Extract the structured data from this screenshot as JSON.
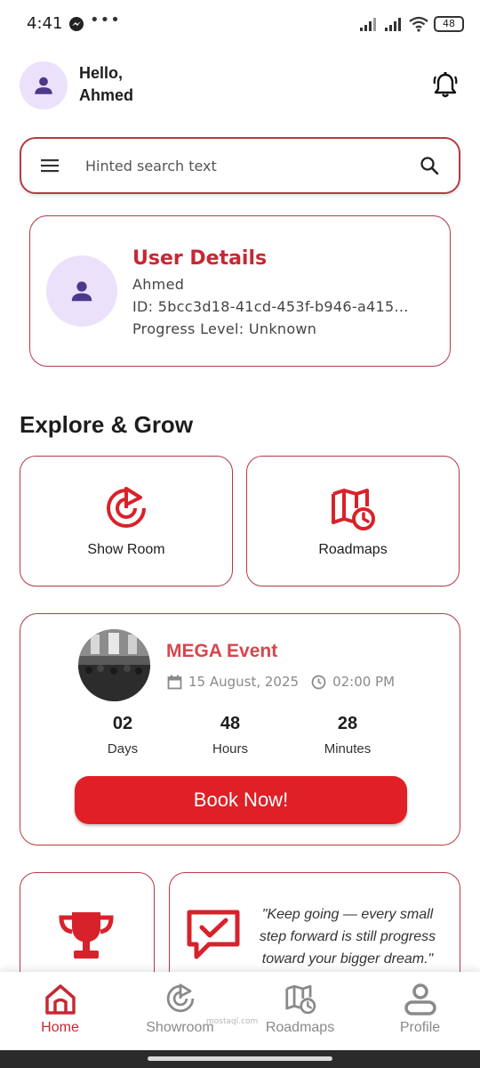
{
  "status_bar": {
    "time": "4:41",
    "dots": "•••",
    "battery": "48"
  },
  "header": {
    "greeting": "Hello,",
    "user_name": "Ahmed"
  },
  "search": {
    "placeholder": "Hinted search text"
  },
  "user_card": {
    "title": "User Details",
    "name": "Ahmed",
    "id_line": "ID: 5bcc3d18-41cd-453f-b946-a415...",
    "progress_line": "Progress Level: Unknown"
  },
  "section": {
    "title": "Explore & Grow"
  },
  "tiles": [
    {
      "label": "Show Room",
      "icon": "showroom-icon"
    },
    {
      "label": "Roadmaps",
      "icon": "roadmaps-icon"
    }
  ],
  "event": {
    "title": "MEGA Event",
    "date": "15 August, 2025",
    "time": "02:00 PM",
    "countdown": [
      {
        "value": "02",
        "label": "Days"
      },
      {
        "value": "48",
        "label": "Hours"
      },
      {
        "value": "28",
        "label": "Minutes"
      }
    ],
    "button_label": "Book Now!"
  },
  "quote": {
    "line1": "\"Keep going — every small",
    "line2": "step forward is still progress",
    "line3": "toward your bigger dream.\""
  },
  "nav": [
    {
      "label": "Home",
      "icon": "home-icon",
      "active": true
    },
    {
      "label": "Showroom",
      "icon": "showroom-icon",
      "active": false
    },
    {
      "label": "Roadmaps",
      "icon": "roadmaps-icon",
      "active": false
    },
    {
      "label": "Profile",
      "icon": "profile-icon",
      "active": false
    }
  ],
  "watermark": "mostaql.com",
  "colors": {
    "accent": "#c62833",
    "button": "#e01f26",
    "border": "#b43a44",
    "avatar_bg": "#ece1fb",
    "avatar_fg": "#4a3a8c"
  }
}
